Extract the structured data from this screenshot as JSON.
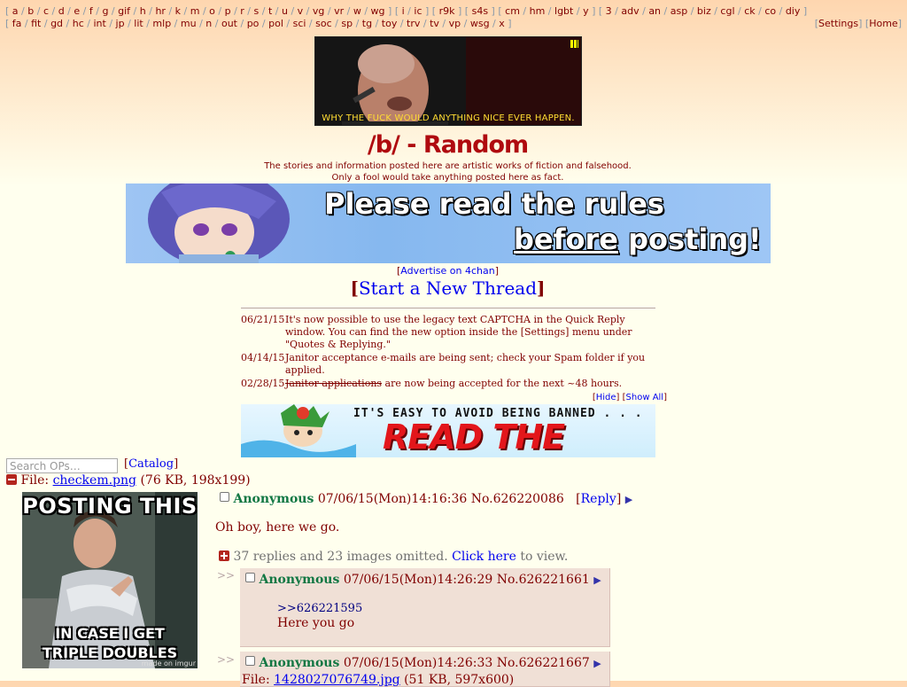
{
  "nav": {
    "row1": [
      "a",
      "b",
      "c",
      "d",
      "e",
      "f",
      "g",
      "gif",
      "h",
      "hr",
      "k",
      "m",
      "o",
      "p",
      "r",
      "s",
      "t",
      "u",
      "v",
      "vg",
      "vr",
      "w",
      "wg"
    ],
    "row1b": [
      "i",
      "ic"
    ],
    "row1c": [
      "r9k"
    ],
    "row1d": [
      "s4s"
    ],
    "row1e": [
      "cm",
      "hm",
      "lgbt",
      "y"
    ],
    "row1f": [
      "3",
      "adv",
      "an",
      "asp",
      "biz",
      "cgl",
      "ck",
      "co",
      "diy"
    ],
    "row2": [
      "fa",
      "fit",
      "gd",
      "hc",
      "int",
      "jp",
      "lit",
      "mlp",
      "mu",
      "n",
      "out",
      "po",
      "pol",
      "sci",
      "soc",
      "sp",
      "tg",
      "toy",
      "trv",
      "tv",
      "vp",
      "wsg",
      "x"
    ],
    "settings": "Settings",
    "home": "Home"
  },
  "top_banner": {
    "caption": "WHY THE FUCK WOULD ANYTHING NICE EVER HAPPEN."
  },
  "board": {
    "title": "/b/ - Random",
    "disclaimer1": "The stories and information posted here are artistic works of fiction and falsehood.",
    "disclaimer2": "Only a fool would take anything posted here as fact."
  },
  "rules_banner": {
    "line1": "Please read the rules",
    "line2_u": "before",
    "line2_rest": " posting!"
  },
  "advertise": "Advertise on 4chan",
  "new_thread": "Start a New Thread",
  "news": [
    {
      "date": "06/21/15",
      "text": "It's now possible to use the legacy text CAPTCHA in the Quick Reply window. You can find the new option inside the [Settings] menu under \"Quotes & Replying.\""
    },
    {
      "date": "04/14/15",
      "text": "Janitor acceptance e-mails are being sent; check your Spam folder if you applied."
    },
    {
      "date": "02/28/15",
      "strike": "Janitor applications",
      "text": " are now being accepted for the next ~48 hours."
    }
  ],
  "news_toggle": {
    "hide": "Hide",
    "show_all": "Show All"
  },
  "ban_banner": {
    "small": "IT'S EASY TO AVOID BEING BANNED . . .",
    "big": "READ THE RULES"
  },
  "search": {
    "placeholder": "Search OPs…",
    "catalog": "Catalog"
  },
  "op": {
    "file_label": "File: ",
    "file_name": "checkem.png",
    "file_meta": " (76 KB, 198x199)",
    "thumb_top": "POSTING THIS",
    "thumb_bottom1": "IN CASE I GET",
    "thumb_bottom2": "TRIPLE DOUBLES",
    "thumb_watermark": "made on imgur",
    "name": "Anonymous",
    "datetime": "07/06/15(Mon)14:16:36",
    "post_no": "No.626220086",
    "reply_label": "Reply",
    "comment": "Oh boy, here we go.",
    "omitted": "37 replies and 23 images omitted.",
    "click_here": "Click here",
    "to_view": " to view."
  },
  "replies": [
    {
      "name": "Anonymous",
      "datetime": "07/06/15(Mon)14:26:29",
      "post_no": "No.626221661",
      "quote": ">>626221595",
      "comment": "Here you go"
    },
    {
      "name": "Anonymous",
      "datetime": "07/06/15(Mon)14:26:33",
      "post_no": "No.626221667",
      "file_label": "File: ",
      "file_name": "1428027076749.jpg",
      "file_meta": " (51 KB, 597x600)"
    }
  ],
  "reply_marker": ">>"
}
